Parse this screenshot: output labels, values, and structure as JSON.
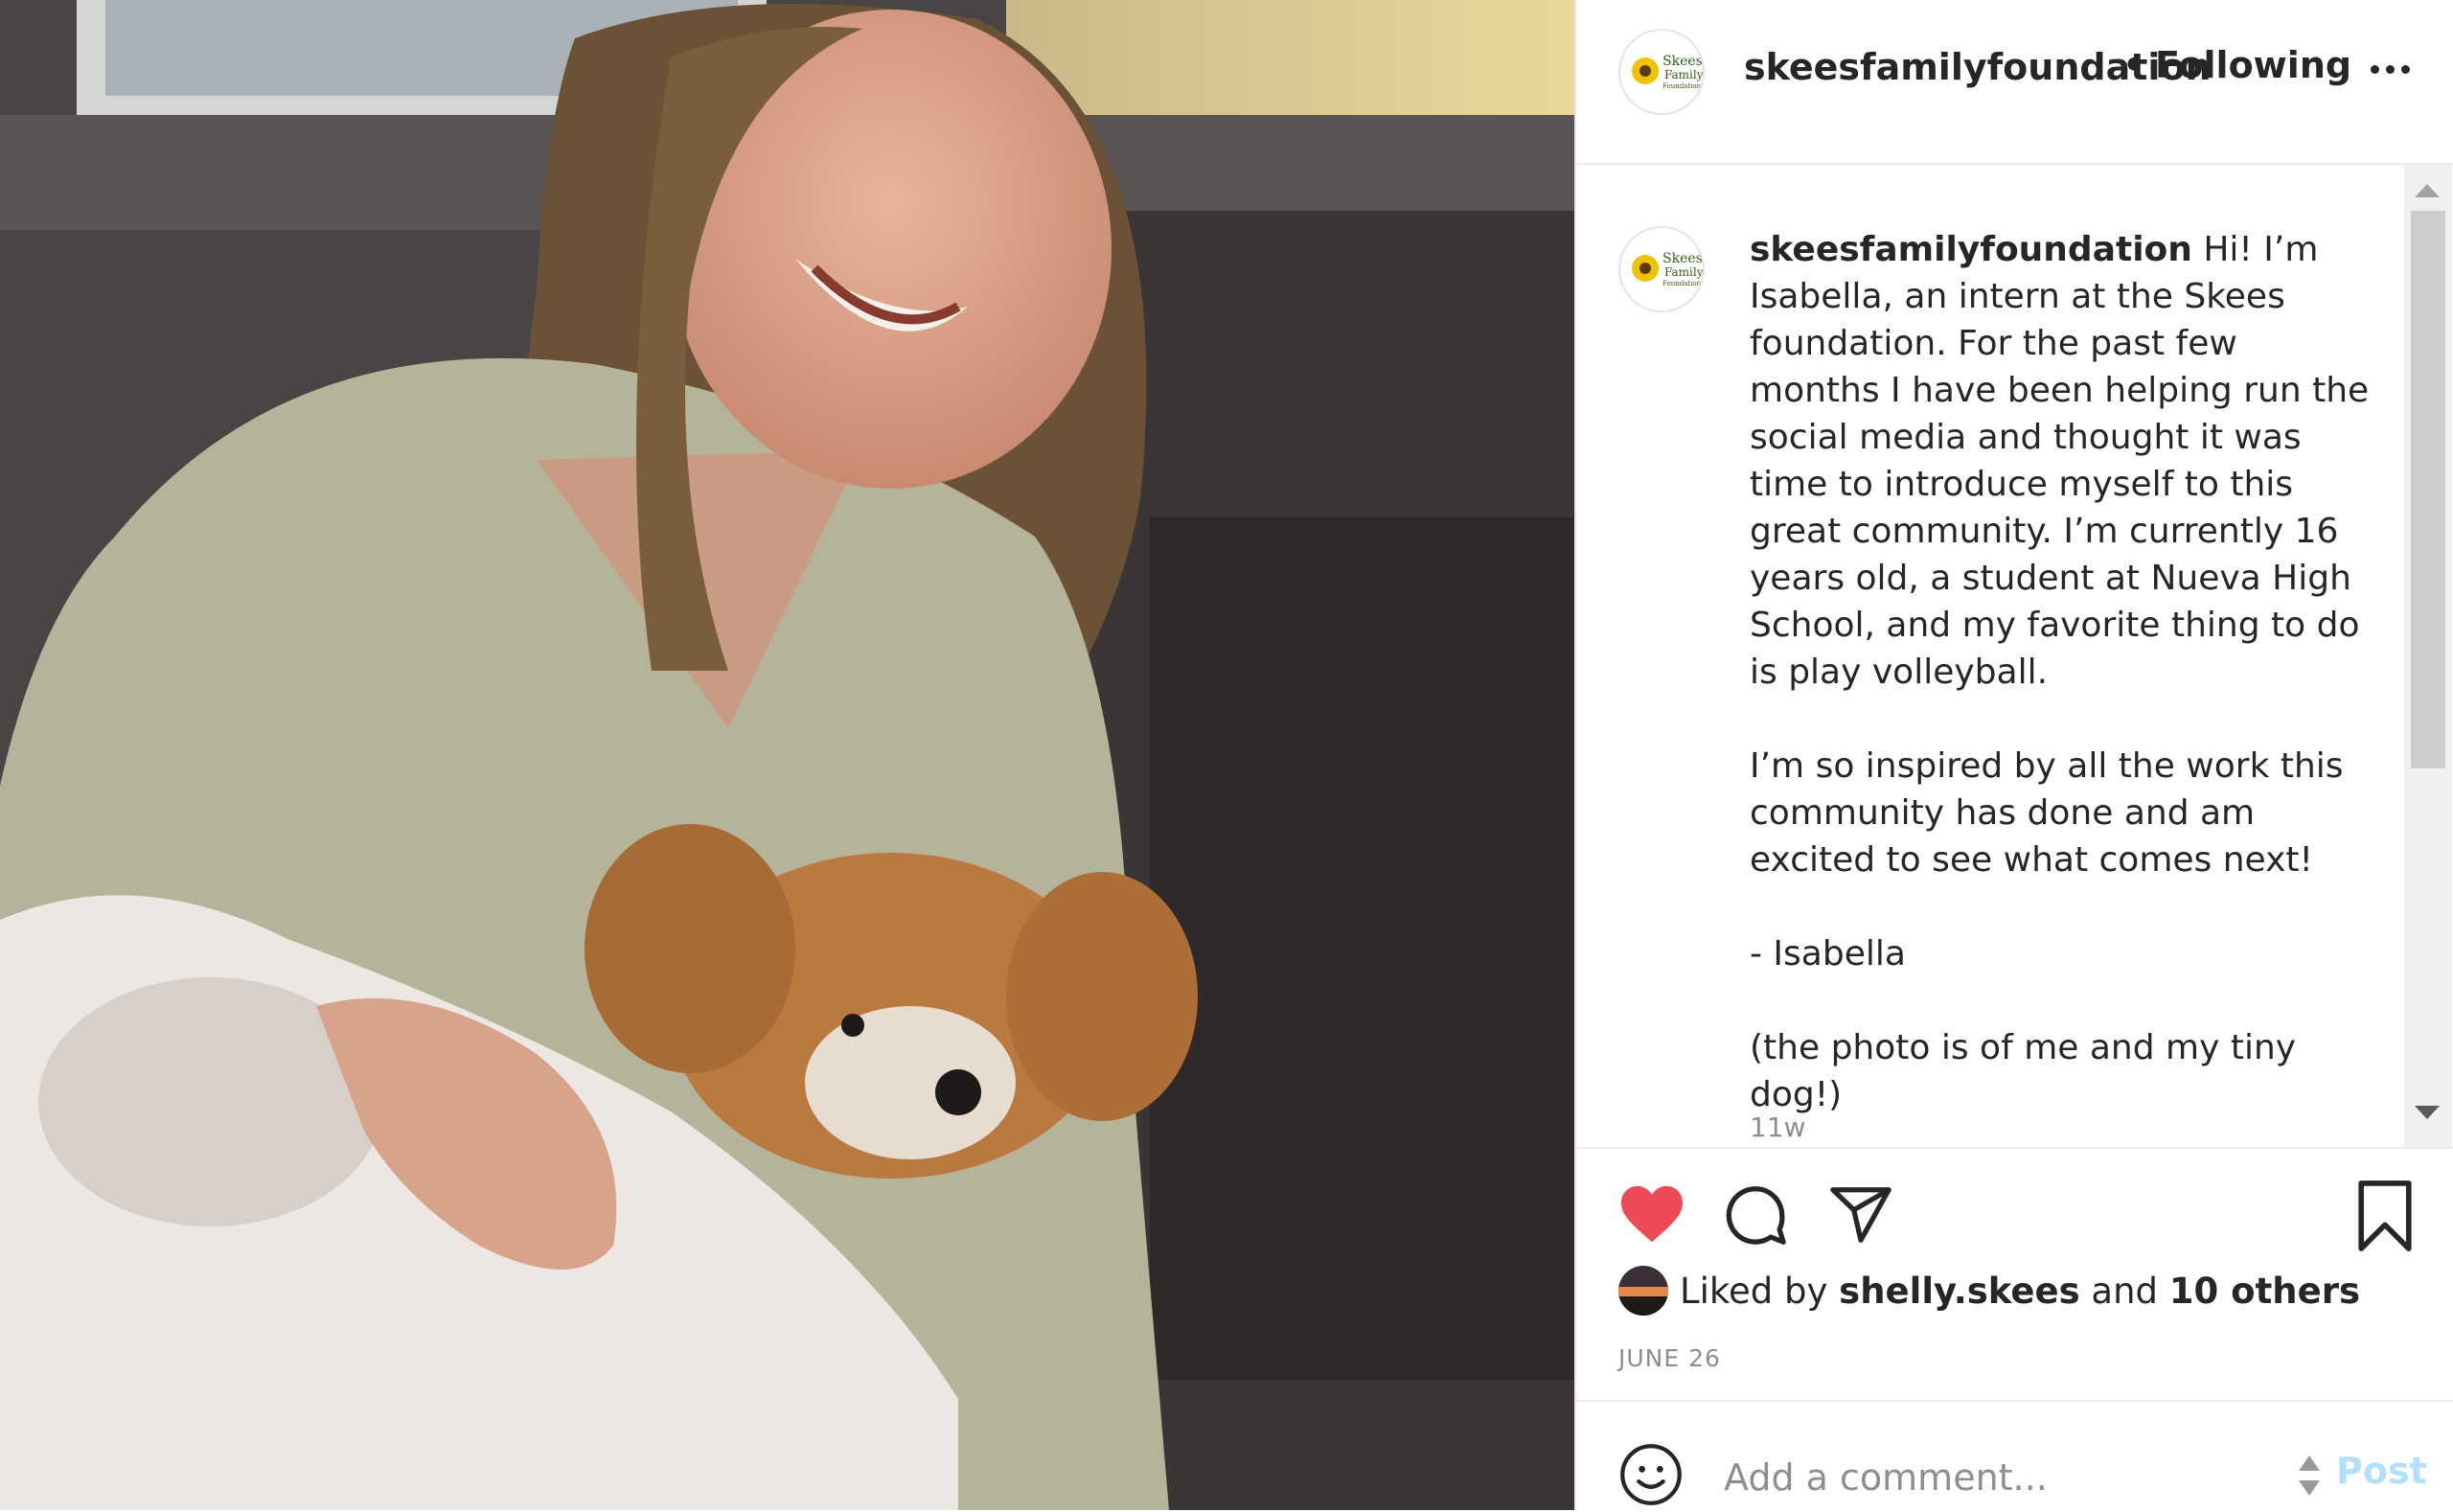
{
  "post": {
    "username": "skeesfamilyfoundation",
    "separator": "•",
    "follow_status": "Following",
    "caption_paragraphs": [
      "Hi! I’m Isabella, an intern at the Skees foundation. For the past few months I have been helping run the social media and thought it was time to introduce myself to this great community. I’m currently 16 years old, a student at Nueva High School, and my favorite thing to do is play volleyball.",
      "I’m so inspired by all the work this community has done and am excited to see what comes next!",
      "- Isabella",
      "(the photo is of me and my tiny dog!)"
    ],
    "time_ago": "11w",
    "likes": {
      "prefix": "Liked by",
      "user": "shelly.skees",
      "conjunction": "and",
      "others": "10 others"
    },
    "date": "JUNE 26"
  },
  "add_comment": {
    "placeholder": "Add a comment...",
    "post_label": "Post"
  },
  "icons": {
    "like": "heart-icon",
    "comment": "speech-bubble-icon",
    "share": "paper-plane-icon",
    "save": "bookmark-icon",
    "emoji": "smiley-icon",
    "more": "more-dots-icon"
  },
  "colors": {
    "like_red": "#ed4956",
    "post_button": "#b2dffc",
    "muted_text": "#8e8e8e"
  }
}
